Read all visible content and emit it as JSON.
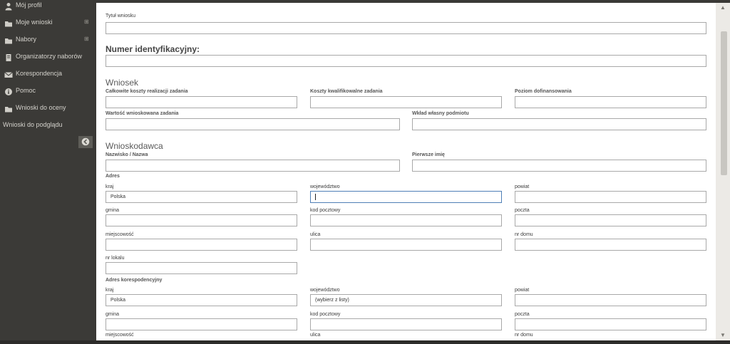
{
  "sidebar": {
    "items": [
      {
        "label": "Mój profil",
        "icon": "user-icon"
      },
      {
        "label": "Moje wnioski",
        "icon": "folder-icon",
        "expand": "⊞"
      },
      {
        "label": "Nabory",
        "icon": "folder-icon",
        "expand": "⊞"
      },
      {
        "label": "Organizatorzy naborów",
        "icon": "document-icon"
      },
      {
        "label": "Korespondencja",
        "icon": "envelope-icon"
      },
      {
        "label": "Pomoc",
        "icon": "info-icon"
      },
      {
        "label": "Wnioski do oceny",
        "icon": "folder-icon"
      },
      {
        "label": "Wnioski do podglądu"
      }
    ]
  },
  "form": {
    "tytul_label": "Tytuł wniosku",
    "tytul_value": "",
    "numer_heading": "Numer identyfikacyjny:",
    "wniosek_heading": "Wniosek",
    "koszty_calkowite": "Całkowite koszty realizacji zadania",
    "koszty_kwalifikowalne": "Koszty kwalifikowalne zadania",
    "poziom_dofinansowania": "Poziom dofinansowania",
    "wartosc_wnioskowana": "Wartość wnioskowana zadania",
    "wklad_wlasny": "Wkład własny podmiotu",
    "wnioskodawca_heading": "Wnioskodawca",
    "nazwisko": "Nazwisko / Nazwa",
    "pierwsze_imie": "Pierwsze imię",
    "adres_heading": "Adres",
    "adres": {
      "kraj_label": "kraj",
      "kraj_value": "Polska",
      "wojewodztwo_label": "województwo",
      "wojewodztwo_value": "",
      "powiat_label": "powiat",
      "gmina_label": "gmina",
      "kod_label": "kod pocztowy",
      "poczta_label": "poczta",
      "miejscowosc_label": "miejscowość",
      "ulica_label": "ulica",
      "nr_domu_label": "nr domu",
      "nr_lokalu_label": "nr lokalu"
    },
    "adres_kor_heading": "Adres korespodencyjny",
    "adres_kor": {
      "kraj_label": "kraj",
      "kraj_value": "Polska",
      "wojewodztwo_label": "województwo",
      "wojewodztwo_value": "(wybierz z listy)",
      "powiat_label": "powiat",
      "gmina_label": "gmina",
      "kod_label": "kod pocztowy",
      "poczta_label": "poczta",
      "miejscowosc_label": "miejscowość",
      "ulica_label": "ulica",
      "nr_domu_label": "nr domu"
    }
  },
  "colors": {
    "sidebar_bg": "#3b3a37",
    "focus_border": "#4f7fb6"
  }
}
